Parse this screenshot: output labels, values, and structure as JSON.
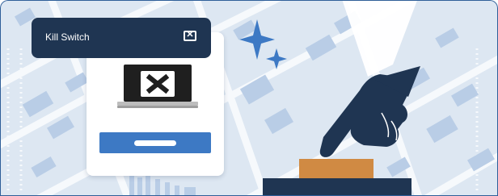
{
  "window": {
    "title": "Kill Switch",
    "close_glyph": "✕"
  },
  "icons": {
    "close": "close-icon",
    "screen_x": "x-mark-icon",
    "sparkle": "sparkle-icon",
    "hand": "pointing-hand-icon"
  },
  "colors": {
    "map_background": "#dde7f2",
    "road": "#f6f9fc",
    "block": "#b9cde6",
    "navy": "#1f3552",
    "accent_blue": "#3d79c4",
    "button_orange": "#d08a43",
    "sparkle": "#3d79c4"
  }
}
